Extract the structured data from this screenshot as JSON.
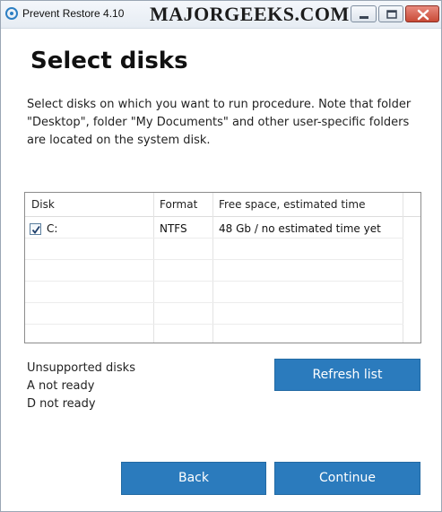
{
  "window": {
    "title": "Prevent Restore 4.10",
    "watermark": "MAJORGEEKS.COM",
    "controls": {
      "minimize": "minimize-icon",
      "maximize": "maximize-icon",
      "close": "close-icon"
    }
  },
  "page": {
    "heading": "Select disks",
    "description_lines": [
      "Select disks on which you want to run procedure. Note that folder",
      "\"Desktop\", folder \"My Documents\" and other user-specific folders",
      "are located on the system disk."
    ]
  },
  "table": {
    "columns": [
      "Disk",
      "Format",
      "Free space, estimated time"
    ],
    "rows": [
      {
        "checked": true,
        "disk": "C:",
        "format": "NTFS",
        "free_space": "48 Gb / no estimated time yet"
      }
    ]
  },
  "unsupported": {
    "title": "Unsupported disks",
    "items": [
      "A not ready",
      "D not ready"
    ]
  },
  "buttons": {
    "refresh": "Refresh list",
    "back": "Back",
    "continue": "Continue"
  },
  "colors": {
    "button_blue": "#2b7bbd",
    "close_red": "#c84a36"
  }
}
